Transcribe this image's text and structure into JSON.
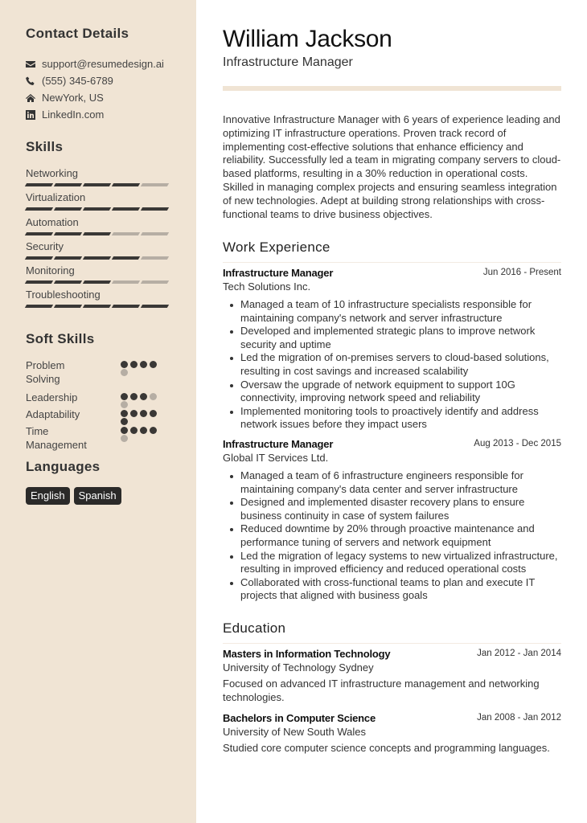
{
  "sidebar": {
    "contact": {
      "heading": "Contact Details",
      "items": [
        {
          "icon": "envelope-icon",
          "text": "support@resumedesign.ai"
        },
        {
          "icon": "phone-icon",
          "text": "(555) 345-6789"
        },
        {
          "icon": "home-icon",
          "text": "NewYork, US"
        },
        {
          "icon": "linkedin-icon",
          "text": "LinkedIn.com"
        }
      ]
    },
    "skills": {
      "heading": "Skills",
      "max": 5,
      "items": [
        {
          "name": "Networking",
          "level": 4
        },
        {
          "name": "Virtualization",
          "level": 5
        },
        {
          "name": "Automation",
          "level": 3
        },
        {
          "name": "Security",
          "level": 4
        },
        {
          "name": "Monitoring",
          "level": 3
        },
        {
          "name": "Troubleshooting",
          "level": 5
        }
      ]
    },
    "soft_skills": {
      "heading": "Soft Skills",
      "max": 5,
      "items": [
        {
          "name": "Problem Solving",
          "level": 4
        },
        {
          "name": "Leadership",
          "level": 3
        },
        {
          "name": "Adaptability",
          "level": 5
        },
        {
          "name": "Time Management",
          "level": 4
        }
      ]
    },
    "languages": {
      "heading": "Languages",
      "items": [
        "English",
        "Spanish"
      ]
    }
  },
  "header": {
    "name": "William Jackson",
    "title": "Infrastructure Manager"
  },
  "summary": "Innovative Infrastructure Manager with 6 years of experience leading and optimizing IT infrastructure operations. Proven track record of implementing cost-effective solutions that enhance efficiency and reliability. Successfully led a team in migrating company servers to cloud-based platforms, resulting in a 30% reduction in operational costs. Skilled in managing complex projects and ensuring seamless integration of new technologies. Adept at building strong relationships with cross-functional teams to drive business objectives.",
  "work": {
    "heading": "Work Experience",
    "entries": [
      {
        "title": "Infrastructure Manager",
        "date": "Jun 2016 - Present",
        "org": "Tech Solutions Inc.",
        "bullets": [
          "Managed a team of 10 infrastructure specialists responsible for maintaining company's network and server infrastructure",
          "Developed and implemented strategic plans to improve network security and uptime",
          "Led the migration of on-premises servers to cloud-based solutions, resulting in cost savings and increased scalability",
          "Oversaw the upgrade of network equipment to support 10G connectivity, improving network speed and reliability",
          "Implemented monitoring tools to proactively identify and address network issues before they impact users"
        ]
      },
      {
        "title": "Infrastructure Manager",
        "date": "Aug 2013 - Dec 2015",
        "org": "Global IT Services Ltd.",
        "bullets": [
          "Managed a team of 6 infrastructure engineers responsible for maintaining company's data center and server infrastructure",
          "Designed and implemented disaster recovery plans to ensure business continuity in case of system failures",
          "Reduced downtime by 20% through proactive maintenance and performance tuning of servers and network equipment",
          "Led the migration of legacy systems to new virtualized infrastructure, resulting in improved efficiency and reduced operational costs",
          "Collaborated with cross-functional teams to plan and execute IT projects that aligned with business goals"
        ]
      }
    ]
  },
  "education": {
    "heading": "Education",
    "entries": [
      {
        "title": "Masters in Information Technology",
        "date": "Jan 2012 - Jan 2014",
        "org": "University of Technology Sydney",
        "desc": "Focused on advanced IT infrastructure management and networking technologies."
      },
      {
        "title": "Bachelors in Computer Science",
        "date": "Jan 2008 - Jan 2012",
        "org": "University of New South Wales",
        "desc": "Studied core computer science concepts and programming languages."
      }
    ]
  },
  "colors": {
    "sidebar_bg": "#f0e4d4",
    "accent_bar": "#f0e4d4",
    "level_on": "#3a3836",
    "level_off": "#b6aea4",
    "badge_bg": "#2b2a29"
  }
}
